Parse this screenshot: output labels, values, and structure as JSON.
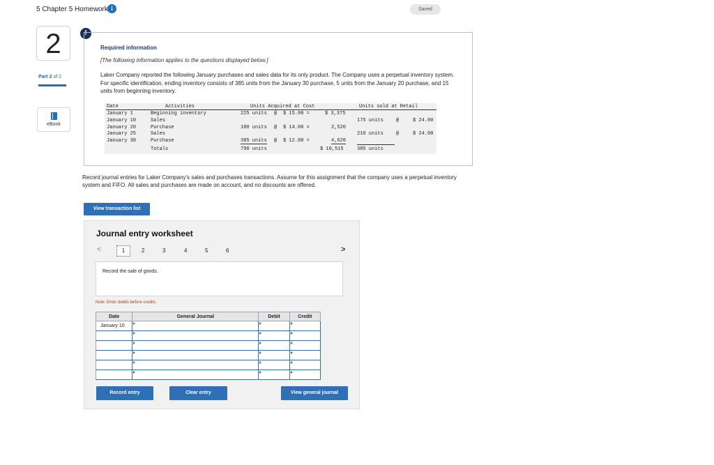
{
  "header": {
    "title": "5 Chapter 5 Homework",
    "saved": "Saved"
  },
  "sidebar": {
    "question_number": "2",
    "part_prefix": "Part",
    "part_number": "2",
    "part_of": "of 2",
    "ebook_label": "eBook"
  },
  "required": {
    "alert": "!",
    "title": "Required information",
    "subtitle": "[The following information applies to the questions displayed below.]",
    "paragraph": "Laker Company reported the following January purchases and sales data for its only product. The Company uses a perpetual inventory system. For specific identification, ending inventory consists of 385 units from the January 30 purchase, 5 units from the January 20 purchase, and 15 units from beginning inventory."
  },
  "data_table": {
    "headers": {
      "date": "Date",
      "activities": "Activities",
      "acquired": "Units Acquired at Cost",
      "sold": "Units sold at Retail"
    },
    "rows": [
      {
        "date": "January 1",
        "activity": "Beginning inventory",
        "units": "225 units",
        "at": "@",
        "cost": "$ 15.00 =",
        "total": "$ 3,375",
        "sold_units": "",
        "sold_at": "",
        "retail": ""
      },
      {
        "date": "January 10",
        "activity": "Sales",
        "units": "",
        "at": "",
        "cost": "",
        "total": "",
        "sold_units": "175 units",
        "sold_at": "@",
        "retail": "$ 24.00"
      },
      {
        "date": "January 20",
        "activity": "Purchase",
        "units": "180 units",
        "at": "@",
        "cost": "$ 14.00 =",
        "total": "2,520",
        "sold_units": "",
        "sold_at": "",
        "retail": ""
      },
      {
        "date": "January 25",
        "activity": "Sales",
        "units": "",
        "at": "",
        "cost": "",
        "total": "",
        "sold_units": "210 units",
        "sold_at": "@",
        "retail": "$ 24.00"
      },
      {
        "date": "January 30",
        "activity": "Purchase",
        "units": "385 units",
        "at": "@",
        "cost": "$ 12.00 =",
        "total": "4,620",
        "sold_units": "",
        "sold_at": "",
        "retail": ""
      }
    ],
    "totals": {
      "label": "Totals",
      "units": "790 units",
      "total": "$ 10,515",
      "sold_units": "385 units"
    }
  },
  "instructions": "Record journal entries for Laker Company's sales and purchases transactions. Assume for this assignment that the company uses a perpetual inventory system and FIFO. All sales and purchases are made on account, and no discounts are offered.",
  "buttons": {
    "view_transactions": "View transaction list",
    "record_entry": "Record entry",
    "clear_entry": "Clear entry",
    "view_general_journal": "View general journal"
  },
  "worksheet": {
    "title": "Journal entry worksheet",
    "pages": [
      "1",
      "2",
      "3",
      "4",
      "5",
      "6"
    ],
    "prev": "<",
    "next": ">",
    "description": "Record the sale of goods.",
    "note": "Note: Enter debits before credits.",
    "columns": {
      "date": "Date",
      "general_journal": "General Journal",
      "debit": "Debit",
      "credit": "Credit"
    },
    "first_date": "January 10"
  }
}
